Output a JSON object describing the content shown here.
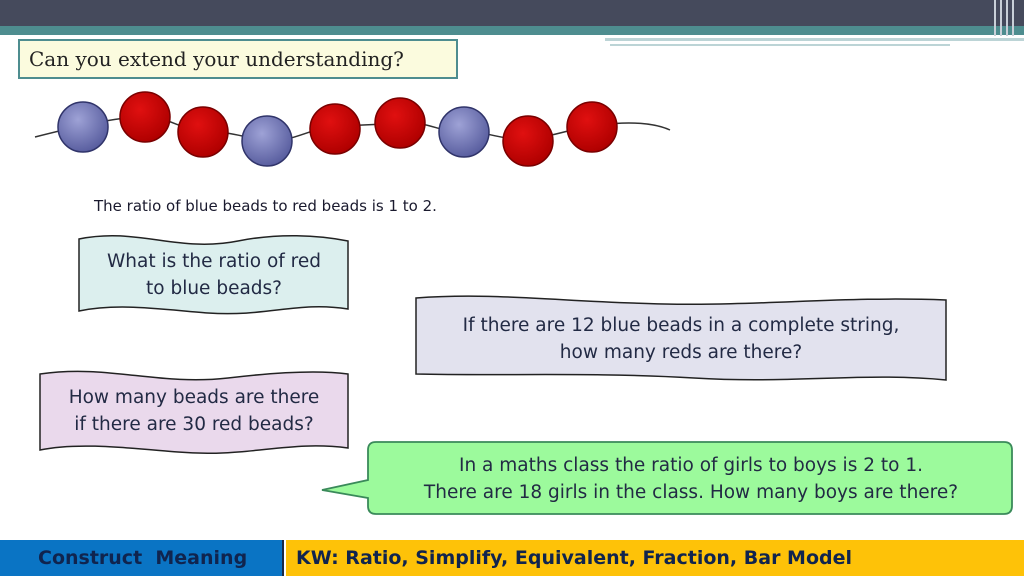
{
  "title": "Can you extend your understanding?",
  "beads": {
    "sequence": [
      "blue",
      "red",
      "red",
      "blue",
      "red",
      "red",
      "blue",
      "red",
      "red"
    ],
    "colors": {
      "blue": "#6a6fb2",
      "red": "#c00000",
      "string": "#333333"
    }
  },
  "statement": "The ratio of blue beads to red beads is 1 to 2.",
  "questions": {
    "q1": {
      "line1": "What is the ratio of red",
      "line2": "to blue beads?",
      "fill": "#dcefee"
    },
    "q2": {
      "line1": "If there are 12 blue beads in a complete string,",
      "line2": "how many reds are there?",
      "fill": "#e2e2ee"
    },
    "q3": {
      "line1": "How many beads are there",
      "line2": "if there are 30 red beads?",
      "fill": "#ead9ec"
    },
    "q4": {
      "line1": "In a maths class the ratio of girls to boys is 2 to 1.",
      "line2": "There are 18 girls in the class. How many boys are there?",
      "fill": "#9cfa9c"
    }
  },
  "footer": {
    "left_label": "Construct  Meaning",
    "right_label": "KW: Ratio, Simplify, Equivalent, Fraction, Bar Model",
    "left_color": "#0a74c4",
    "right_color": "#fec208"
  }
}
